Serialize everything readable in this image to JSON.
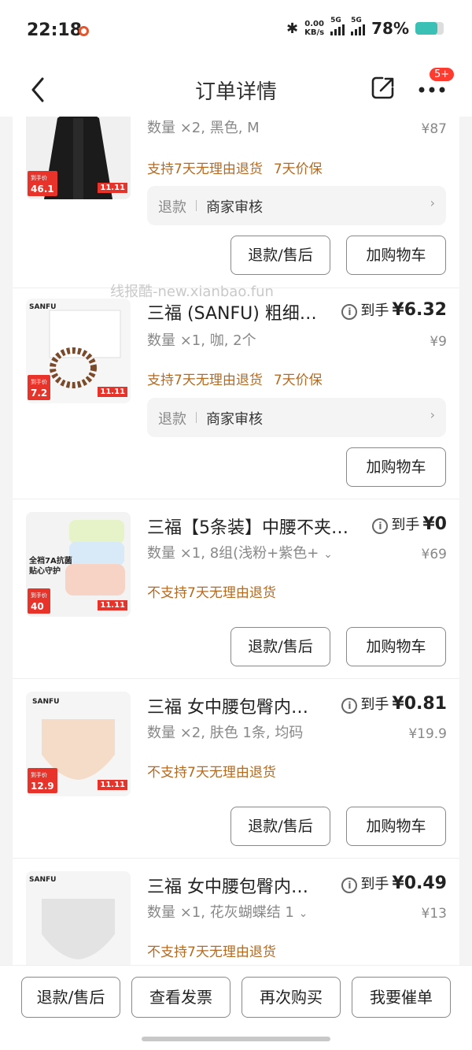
{
  "status": {
    "time": "22:18",
    "speed_value": "0.00",
    "speed_unit": "KB/s",
    "sim1": "5G",
    "sim2": "5G",
    "battery": "78%",
    "battery_level": 0.78
  },
  "nav": {
    "title": "订单详情",
    "badge": "5+"
  },
  "watermark": "线报酷-new.xianbao.fun",
  "items": [
    {
      "title": "",
      "spec": "数量 ×2, 黑色, M",
      "price_label": "",
      "price": "",
      "orig_price": "¥87",
      "policy_a": "支持7天无理由退货",
      "policy_b": "7天价保",
      "refund_label": "退款",
      "refund_status": "商家审核",
      "btn1": "退款/售后",
      "btn2": "加购物车",
      "thumb_tag": "46.1",
      "thumb_tag_small": "到手价",
      "thumb_promo": "11.11"
    },
    {
      "title": "三福 (SANFU) 粗细…",
      "spec": "数量 ×1, 咖, 2个",
      "price_label": "到手",
      "price": "¥6.32",
      "orig_price": "¥9",
      "policy_a": "支持7天无理由退货",
      "policy_b": "7天价保",
      "refund_label": "退款",
      "refund_status": "商家审核",
      "btn2": "加购物车",
      "thumb_tag": "7.2",
      "thumb_tag_small": "到手价",
      "thumb_promo": "11.11",
      "thumb_brand": "SANFU"
    },
    {
      "title": "三福【5条装】中腰不夹…",
      "spec": "数量 ×1, 8组(浅粉+紫色+",
      "price_label": "到手",
      "price": "¥0",
      "orig_price": "¥69",
      "policy_a": "不支持7天无理由退货",
      "btn1": "退款/售后",
      "btn2": "加购物车",
      "thumb_tag": "40",
      "thumb_tag_small": "到手价",
      "thumb_promo": "11.11",
      "thumb_text": "全裆7A抗菌",
      "thumb_text2": "贴心守护"
    },
    {
      "title": "三福 女中腰包臀内…",
      "spec": "数量 ×2, 肤色 1条, 均码",
      "price_label": "到手",
      "price": "¥0.81",
      "orig_price": "¥19.9",
      "policy_a": "不支持7天无理由退货",
      "btn1": "退款/售后",
      "btn2": "加购物车",
      "thumb_tag": "12.9",
      "thumb_tag_small": "到手价",
      "thumb_promo": "11.11",
      "thumb_brand": "SANFU"
    },
    {
      "title": "三福 女中腰包臀内…",
      "spec": "数量 ×1, 花灰蝴蝶结 1",
      "price_label": "到手",
      "price": "¥0.49",
      "orig_price": "¥13",
      "policy_a": "不支持7天无理由退货",
      "thumb_brand": "SANFU"
    }
  ],
  "bottom": {
    "b1": "退款/售后",
    "b2": "查看发票",
    "b3": "再次购买",
    "b4": "我要催单"
  },
  "colors": {
    "policy": "#b56a1f",
    "badge": "#ff3b30",
    "tag": "#e8332b"
  }
}
